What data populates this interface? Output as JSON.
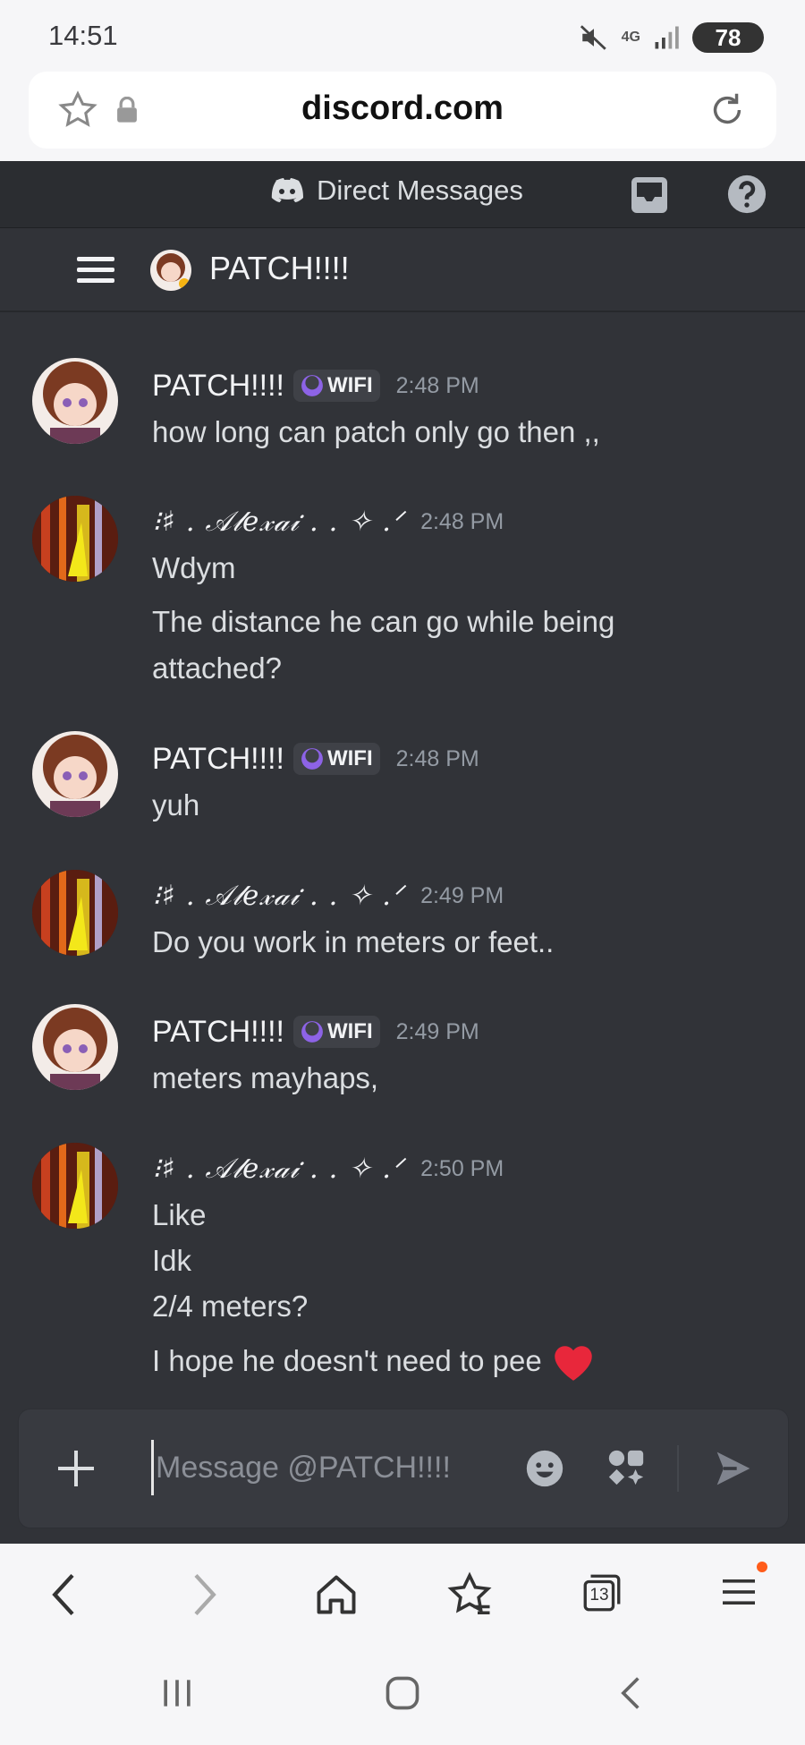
{
  "status_bar": {
    "time": "14:51",
    "network": "4G",
    "battery": "78",
    "icons": [
      "mute-icon",
      "4g-icon",
      "signal-icon",
      "battery-icon"
    ]
  },
  "browser": {
    "url": "discord.com",
    "tab_count": "13"
  },
  "discord": {
    "top_title": "Direct Messages",
    "channel_name": "PATCH!!!!",
    "composer_placeholder": "Message @PATCH!!!!",
    "colors": {
      "background": "#313338",
      "header": "#2b2d31",
      "tag_bg": "#3f4147",
      "timestamp": "#949ba4",
      "heart": "#e8273b"
    }
  },
  "messages": [
    {
      "author": "PATCH!!!!",
      "tag": "WIFI",
      "time": "2:48 PM",
      "lines": [
        "how long can patch only go then ,,"
      ]
    },
    {
      "author": "⁝♯ . 𝒜𝓁𝑒𝓍𝒶𝒾 . . ✧ .ᐟ",
      "time": "2:48 PM",
      "lines": [
        "Wdym",
        "The distance he can go while being",
        "attached?"
      ]
    },
    {
      "author": "PATCH!!!!",
      "tag": "WIFI",
      "time": "2:48 PM",
      "lines": [
        "yuh"
      ]
    },
    {
      "author": "⁝♯ . 𝒜𝓁𝑒𝓍𝒶𝒾 . . ✧ .ᐟ",
      "time": "2:49 PM",
      "lines": [
        "Do you work in meters or feet.."
      ]
    },
    {
      "author": "PATCH!!!!",
      "tag": "WIFI",
      "time": "2:49 PM",
      "lines": [
        "meters mayhaps,"
      ]
    },
    {
      "author": "⁝♯ . 𝒜𝓁𝑒𝓍𝒶𝒾 . . ✧ .ᐟ",
      "time": "2:50 PM",
      "lines": [
        "Like",
        "Idk",
        "2/4 meters?",
        "I hope he doesn't need to pee"
      ]
    }
  ]
}
